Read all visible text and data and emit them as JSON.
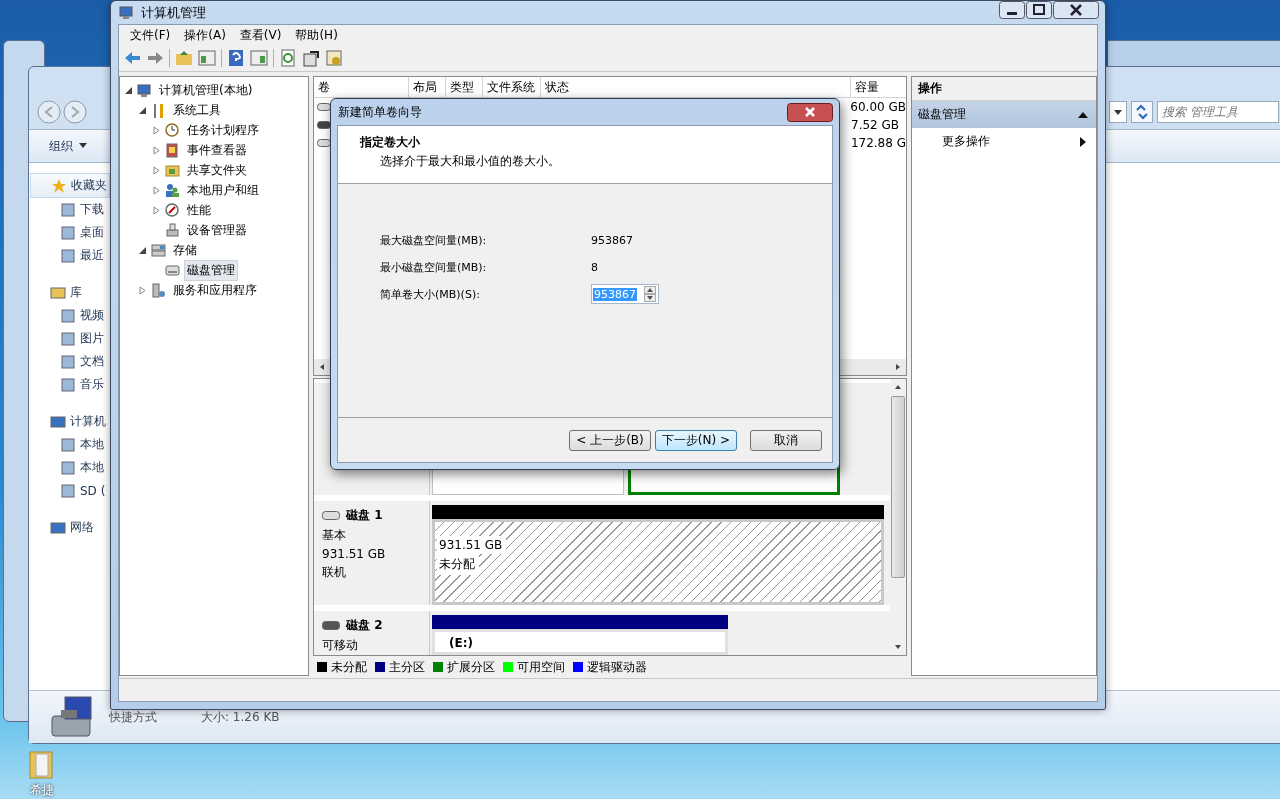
{
  "desktop": {
    "shortcut": {
      "label": "希捷"
    }
  },
  "explorer": {
    "search": {
      "placeholder": "搜索 管理工具"
    },
    "organize": "组织",
    "sidebar": [
      {
        "label": "收藏夹",
        "selected": true,
        "children": [
          {
            "label": "下载",
            "selected": false
          },
          {
            "label": "桌面",
            "selected": false
          },
          {
            "label": "最近",
            "selected": false
          }
        ]
      },
      {
        "label": "库",
        "selected": false,
        "children": [
          {
            "label": "视频",
            "selected": false
          },
          {
            "label": "图片",
            "selected": false
          },
          {
            "label": "文档",
            "selected": false
          },
          {
            "label": "音乐",
            "selected": false
          }
        ]
      },
      {
        "label": "计算机",
        "selected": false,
        "children": [
          {
            "label": "本地",
            "selected": false
          },
          {
            "label": "本地",
            "selected": false
          },
          {
            "label": "SD (",
            "selected": false
          }
        ]
      },
      {
        "label": "网络",
        "selected": false
      }
    ],
    "details": {
      "type": "快捷方式",
      "size": "大小: 1.26 KB"
    }
  },
  "window": {
    "title": "计算机管理",
    "menu": [
      "文件(F)",
      "操作(A)",
      "查看(V)",
      "帮助(H)"
    ],
    "tree": [
      {
        "label": "计算机管理(本地)",
        "expanded": true,
        "selected": false,
        "children": [
          {
            "label": "系统工具",
            "expanded": true,
            "selected": false,
            "children": [
              {
                "label": "任务计划程序",
                "expanded": false,
                "selected": false
              },
              {
                "label": "事件查看器",
                "expanded": false,
                "selected": false
              },
              {
                "label": "共享文件夹",
                "expanded": false,
                "selected": false
              },
              {
                "label": "本地用户和组",
                "expanded": false,
                "selected": false
              },
              {
                "label": "性能",
                "expanded": false,
                "selected": false
              },
              {
                "label": "设备管理器",
                "selected": false
              }
            ]
          },
          {
            "label": "存储",
            "expanded": true,
            "selected": false,
            "children": [
              {
                "label": "磁盘管理",
                "selected": true
              }
            ]
          },
          {
            "label": "服务和应用程序",
            "expanded": false,
            "selected": false
          }
        ]
      }
    ],
    "volume_table": {
      "columns": [
        "卷",
        "布局",
        "类型",
        "文件系统",
        "状态",
        "容量"
      ],
      "rows": [
        {
          "capacity": "60.00 GB"
        },
        {
          "capacity": "7.52 GB"
        },
        {
          "capacity": "172.88 G"
        }
      ]
    },
    "disks": [
      {
        "name": "磁盘 1",
        "type": "基本",
        "size": "931.51 GB",
        "status": "联机",
        "partitions": [
          {
            "kind": "unallocated",
            "color": "#000000",
            "size": "931.51 GB",
            "label": "未分配"
          }
        ]
      },
      {
        "name": "磁盘 2",
        "type": "可移动",
        "partitions": [
          {
            "kind": "primary",
            "color": "#000080",
            "label": "(E:)"
          }
        ]
      }
    ],
    "legend": [
      {
        "label": "未分配",
        "color": "#000000"
      },
      {
        "label": "主分区",
        "color": "#000080"
      },
      {
        "label": "扩展分区",
        "color": "#008000"
      },
      {
        "label": "可用空间",
        "color": "#00ff00"
      },
      {
        "label": "逻辑驱动器",
        "color": "#0000ff"
      }
    ],
    "actions": {
      "title": "操作",
      "sections": [
        {
          "label": "磁盘管理",
          "expanded": true,
          "items": [
            {
              "label": "更多操作"
            }
          ]
        }
      ]
    }
  },
  "dialog": {
    "title": "新建简单卷向导",
    "heading": "指定卷大小",
    "subheading": "选择介于最大和最小值的卷大小。",
    "fields": [
      {
        "kind": "text",
        "label": "最大磁盘空间量(MB):",
        "value": "953867"
      },
      {
        "kind": "text",
        "label": "最小磁盘空间量(MB):",
        "value": "8"
      },
      {
        "kind": "spinner",
        "label": "简单卷大小(MB)(S):",
        "value": "953867",
        "text_selected": true
      }
    ],
    "buttons": [
      {
        "label": "< 上一步(B)",
        "default": false
      },
      {
        "label": "下一步(N) >",
        "default": true
      },
      {
        "label": "取消",
        "default": false
      }
    ]
  }
}
